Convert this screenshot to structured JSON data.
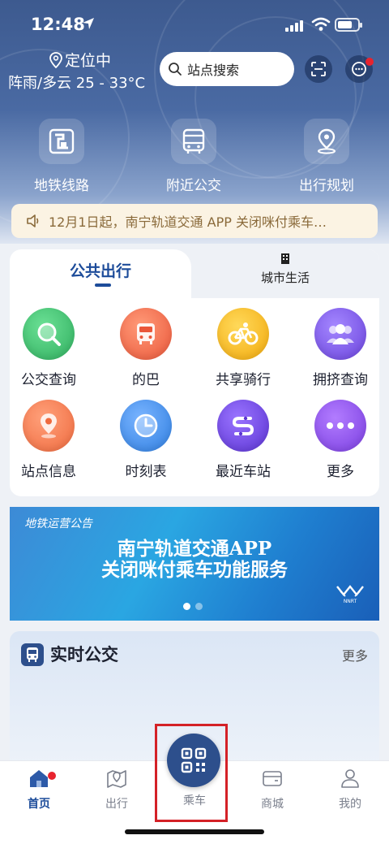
{
  "status_bar": {
    "time": "12:48"
  },
  "header": {
    "location": "定位中",
    "weather": "阵雨/多云 25 - 33°C",
    "search_placeholder": "站点搜索"
  },
  "quick_actions": [
    {
      "label": "地铁线路",
      "icon": "metro-map-icon"
    },
    {
      "label": "附近公交",
      "icon": "bus-icon"
    },
    {
      "label": "出行规划",
      "icon": "route-pin-icon"
    }
  ],
  "notice": {
    "text": "12月1日起，南宁轨道交通 APP 关闭咪付乘车…"
  },
  "service_tabs": {
    "active": "公共出行",
    "inactive": "城市生活"
  },
  "services": [
    {
      "label": "公交查询",
      "icon": "search-icon",
      "color": "#3cbf6e"
    },
    {
      "label": "的巴",
      "icon": "bus-icon",
      "color": "#f26a4b"
    },
    {
      "label": "共享骑行",
      "icon": "bike-icon",
      "color": "#f7b718"
    },
    {
      "label": "拥挤查询",
      "icon": "crowd-icon",
      "color": "#7b5ae6"
    },
    {
      "label": "站点信息",
      "icon": "location-pin-icon",
      "color": "#f47a4f"
    },
    {
      "label": "时刻表",
      "icon": "clock-icon",
      "color": "#3d8bea"
    },
    {
      "label": "最近车站",
      "icon": "route-s-icon",
      "color": "#7047e0"
    },
    {
      "label": "更多",
      "icon": "more-dots-icon",
      "color": "#8a4fe8"
    }
  ],
  "banner": {
    "tag": "地铁运营公告",
    "line1": "南宁轨道交通APP",
    "line2": "关闭咪付乘车功能服务",
    "logo_text": "NNRT"
  },
  "realtime_bus": {
    "title": "实时公交",
    "more": "更多"
  },
  "tabbar": {
    "items": [
      {
        "label": "首页",
        "icon": "home-icon"
      },
      {
        "label": "出行",
        "icon": "map-pin-icon"
      },
      {
        "label": "乘车",
        "icon": "qr-code-icon"
      },
      {
        "label": "商城",
        "icon": "wallet-icon"
      },
      {
        "label": "我的",
        "icon": "user-icon"
      }
    ]
  },
  "colors": {
    "brand": "#2d4f8c",
    "accent": "#1d4c9a",
    "alert": "#e8232e",
    "highlight": "#d42127"
  }
}
